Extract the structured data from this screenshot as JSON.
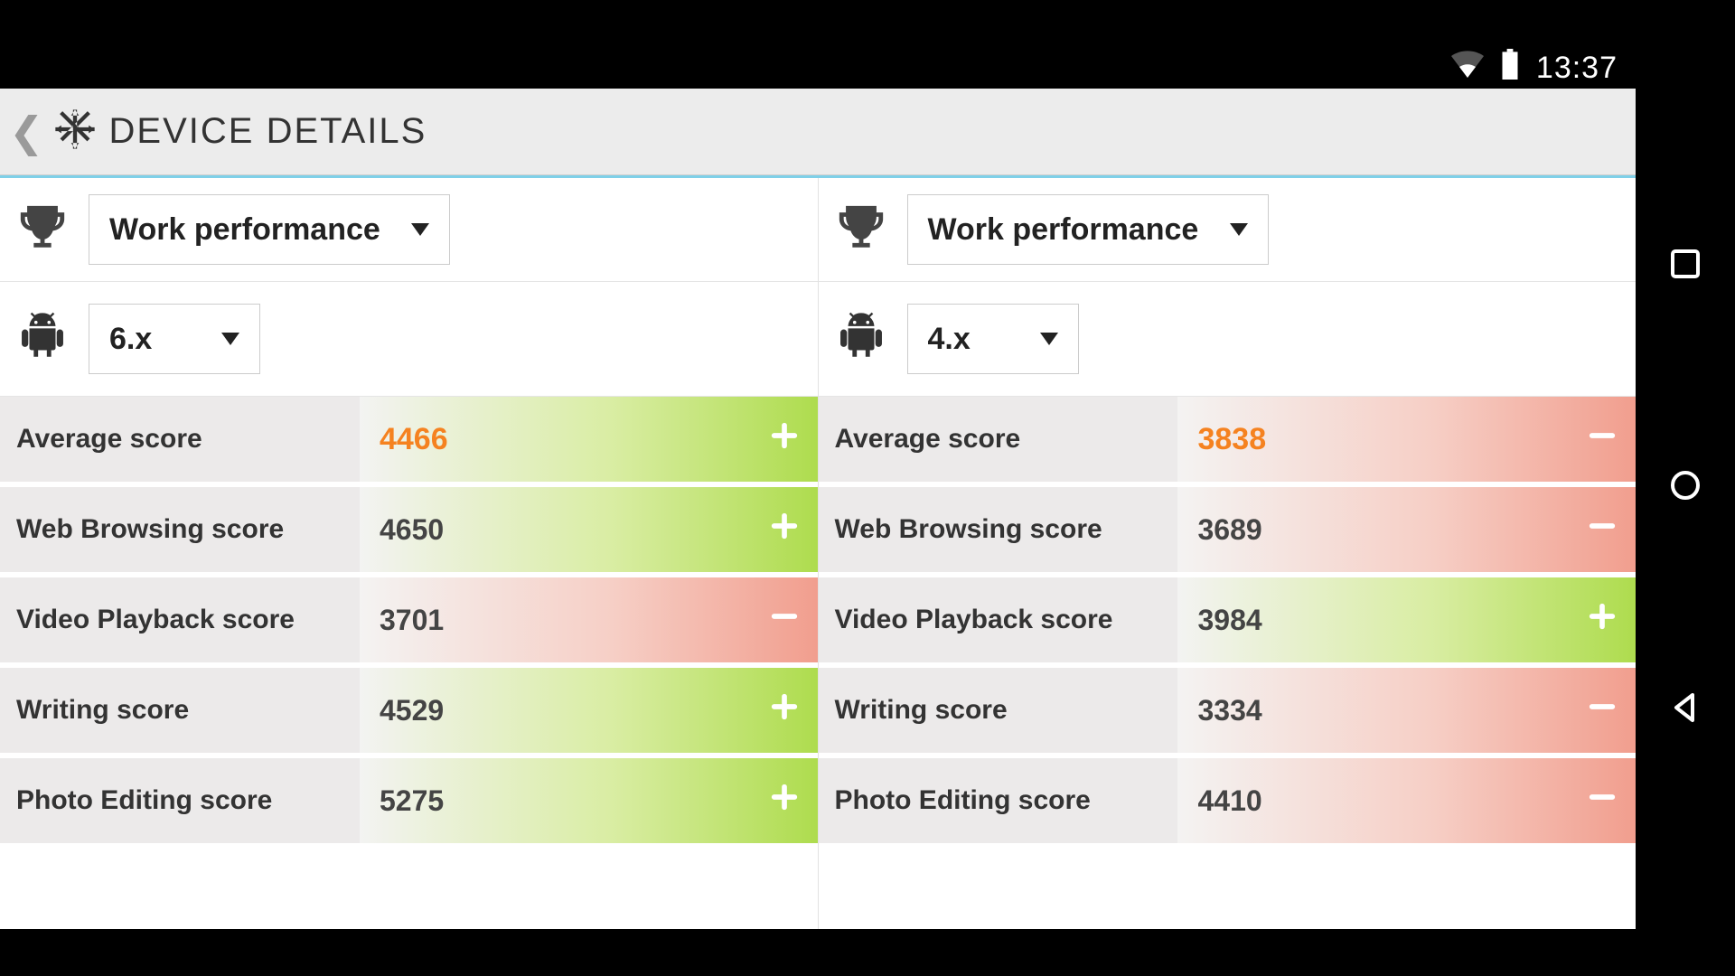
{
  "status_bar": {
    "time": "13:37"
  },
  "header": {
    "title": "DEVICE DETAILS"
  },
  "labels": {
    "average": "Average score",
    "web": "Web Browsing score",
    "video": "Video Playback score",
    "writing": "Writing score",
    "photo": "Photo Editing score"
  },
  "left": {
    "performance_selector": "Work performance",
    "version_selector": "6.x",
    "scores": {
      "average": {
        "value": "4466",
        "indicator": "pos"
      },
      "web": {
        "value": "4650",
        "indicator": "pos"
      },
      "video": {
        "value": "3701",
        "indicator": "neg"
      },
      "writing": {
        "value": "4529",
        "indicator": "pos"
      },
      "photo": {
        "value": "5275",
        "indicator": "pos"
      }
    }
  },
  "right": {
    "performance_selector": "Work performance",
    "version_selector": "4.x",
    "scores": {
      "average": {
        "value": "3838",
        "indicator": "neg"
      },
      "web": {
        "value": "3689",
        "indicator": "neg"
      },
      "video": {
        "value": "3984",
        "indicator": "pos"
      },
      "writing": {
        "value": "3334",
        "indicator": "neg"
      },
      "photo": {
        "value": "4410",
        "indicator": "neg"
      }
    }
  }
}
